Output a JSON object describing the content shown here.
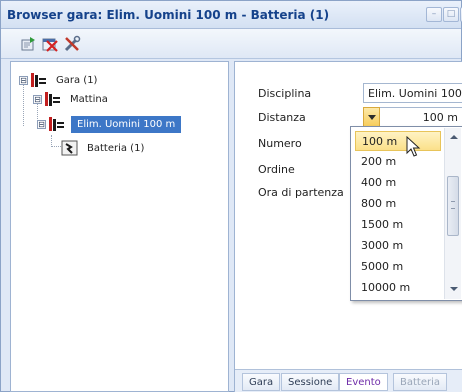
{
  "window": {
    "title": "Browser gara: Elim. Uomini 100 m - Batteria (1)",
    "buttons": [
      "–",
      "□",
      "x"
    ]
  },
  "toolbar": {
    "icons": [
      "export-icon",
      "delete-icon",
      "tools-icon"
    ]
  },
  "tree": {
    "nodes": [
      {
        "label": "Gara (1)",
        "expander": "⊟",
        "selected": false
      },
      {
        "label": "Mattina",
        "expander": "⊟",
        "selected": false
      },
      {
        "label": "Elim. Uomini 100 m",
        "expander": "⊟",
        "selected": true
      },
      {
        "label": "Batteria (1)",
        "expander": "",
        "selected": false
      }
    ]
  },
  "properties": {
    "disciplina_label": "Disciplina",
    "disciplina_value": "Elim. Uomini 100",
    "distanza_label": "Distanza",
    "distanza_value": "100 m",
    "numero_label": "Numero",
    "ordine_label": "Ordine",
    "ora_label": "Ora di partenza"
  },
  "dropdown": {
    "options": [
      "100 m",
      "200 m",
      "400 m",
      "800 m",
      "1500 m",
      "3000 m",
      "5000 m",
      "10000 m"
    ],
    "highlighted_index": 0
  },
  "tabs": [
    {
      "label": "Gara",
      "state": "normal"
    },
    {
      "label": "Sessione",
      "state": "normal"
    },
    {
      "label": "Evento",
      "state": "active"
    },
    {
      "label": "Batteria",
      "state": "disabled"
    }
  ],
  "colors": {
    "selection": "#3d77c7",
    "highlight": "#fbe08a",
    "active_tab_text": "#6f2ca8"
  }
}
